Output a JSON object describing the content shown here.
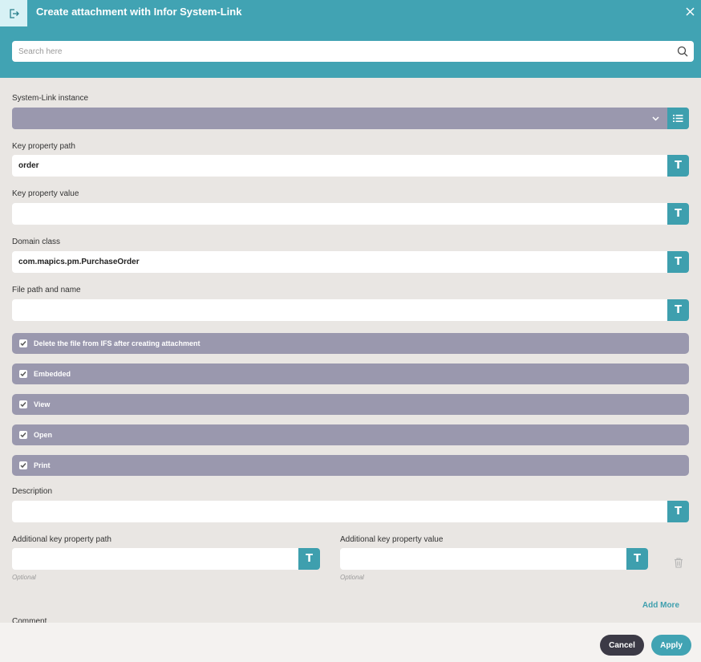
{
  "header": {
    "title": "Create attachment with Infor System-Link",
    "exit_icon": "exit-icon",
    "close_icon": "close-icon",
    "search_placeholder": "Search here",
    "search_icon": "search-icon"
  },
  "form": {
    "system_link_instance": {
      "label": "System-Link instance",
      "value": ""
    },
    "key_property_path": {
      "label": "Key property path",
      "value": "order"
    },
    "key_property_value": {
      "label": "Key property value",
      "value": ""
    },
    "domain_class": {
      "label": "Domain class",
      "value": "com.mapics.pm.PurchaseOrder"
    },
    "file_path_and_name": {
      "label": "File path and name",
      "value": ""
    },
    "checkboxes": [
      {
        "label": "Delete the file from IFS after creating attachment",
        "checked": true
      },
      {
        "label": "Embedded",
        "checked": true
      },
      {
        "label": "View",
        "checked": true
      },
      {
        "label": "Open",
        "checked": true
      },
      {
        "label": "Print",
        "checked": true
      }
    ],
    "description": {
      "label": "Description",
      "value": ""
    },
    "additional_key_property_path": {
      "label": "Additional key property path",
      "value": "",
      "hint": "Optional"
    },
    "additional_key_property_value": {
      "label": "Additional key property value",
      "value": "",
      "hint": "Optional"
    },
    "add_more": "Add More",
    "comment_label": "Comment",
    "text_button_glyph": "T"
  },
  "footer": {
    "cancel": "Cancel",
    "apply": "Apply"
  },
  "colors": {
    "accent": "#41a3b3",
    "checkbox_row": "#9a98ae",
    "cancel_button": "#3c3a46",
    "background": "#e9e6e3"
  }
}
